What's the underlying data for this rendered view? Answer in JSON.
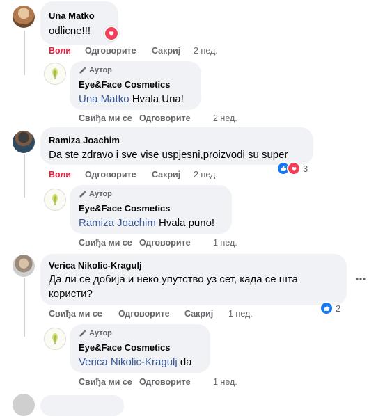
{
  "colors": {
    "accent_blue": "#1877f2",
    "mention": "#385898",
    "like_red": "#e41e3f",
    "bubble": "#f0f2f5",
    "meta": "#65676b"
  },
  "comments": [
    {
      "author": "Una Matko",
      "text": "odlicne!!!",
      "reaction_icon": "heart-icon",
      "actions": {
        "like": "Воли",
        "reply": "Одговорите",
        "hide": "Сакриј",
        "time": "2 нед."
      },
      "reply": {
        "badge": "Аутор",
        "page": "Eye&Face Cosmetics",
        "mention": "Una Matko",
        "text": "Hvala Una!",
        "actions": {
          "like": "Свиђа ми се",
          "reply": "Одговорите",
          "time": "2 нед."
        }
      }
    },
    {
      "author": "Ramiza Joachim",
      "text": "Da ste zdravo i sve vise uspjesni,proizvodi su super",
      "reaction_count": "3",
      "actions": {
        "like": "Воли",
        "reply": "Одговорите",
        "hide": "Сакриј",
        "time": "2 нед."
      },
      "reply": {
        "badge": "Аутор",
        "page": "Eye&Face Cosmetics",
        "mention": "Ramiza Joachim",
        "text": "Hvala puno!",
        "actions": {
          "like": "Свиђа ми се",
          "reply": "Одговорите",
          "time": "1 нед."
        }
      }
    },
    {
      "author": "Verica Nikolic-Kragulj",
      "text_line1": "Да ли се добија и неко упутство уз сет, када се шта",
      "text_line2": "користи?",
      "reaction_count": "2",
      "more_icon": "ellipsis-icon",
      "actions": {
        "like": "Свиђа ми се",
        "reply": "Одговорите",
        "hide": "Сакриј",
        "time": "1 нед."
      },
      "reply": {
        "badge": "Аутор",
        "page": "Eye&Face Cosmetics",
        "mention": "Verica Nikolic-Kragulj",
        "text": "da",
        "actions": {
          "like": "Свиђа ми се",
          "reply": "Одговорите",
          "time": "1 нед."
        }
      }
    }
  ]
}
